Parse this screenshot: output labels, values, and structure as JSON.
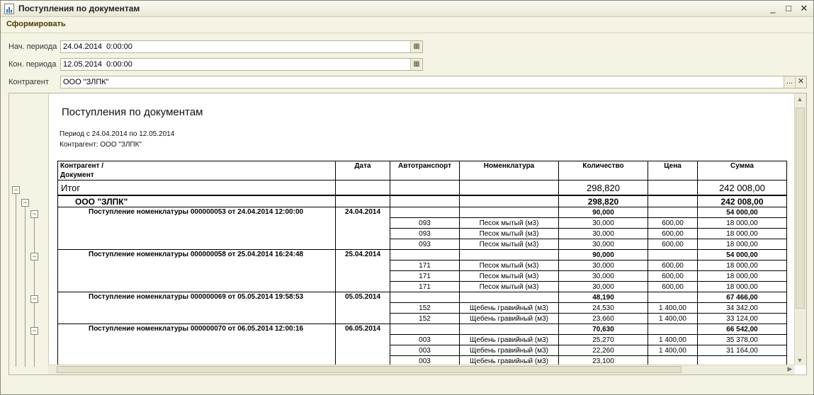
{
  "window": {
    "title": "Поступления по документам",
    "controls": {
      "min": "_",
      "max": "□",
      "close": "✕"
    }
  },
  "toolbar": {
    "generate_label": "Сформировать"
  },
  "form": {
    "start_label": "Нач. периода",
    "start_value": "24.04.2014  0:00:00",
    "end_label": "Кон. периода",
    "end_value": "12.05.2014  0:00:00",
    "counterparty_label": "Контрагент",
    "counterparty_value": "ООО \"ЗЛПК\"",
    "select_glyph": "...",
    "clear_glyph": "✕"
  },
  "report": {
    "title": "Поступления по документам",
    "period_line": "Период с 24.04.2014 по 12.05.2014",
    "counterparty_line": "Контрагент: ООО \"ЗЛПК\"",
    "columns": [
      "Контрагент /\nДокумент",
      "Дата",
      "Автотранспорт",
      "Номенклатура",
      "Количество",
      "Цена",
      "Сумма"
    ],
    "total": {
      "label": "Итог",
      "qty": "298,820",
      "sum": "242 008,00"
    },
    "counterparty_row": {
      "label": "ООО \"ЗЛПК\"",
      "qty": "298,820",
      "sum": "242 008,00"
    },
    "documents": [
      {
        "name": "Поступление номенклатуры 000000053 от 24.04.2014 12:00:00",
        "date": "24.04.2014",
        "qty": "90,000",
        "sum": "54 000,00",
        "lines": [
          {
            "vehicle": "093",
            "item": "Песок мытый (м3)",
            "qty": "30,000",
            "price": "600,00",
            "sum": "18 000,00"
          },
          {
            "vehicle": "093",
            "item": "Песок мытый (м3)",
            "qty": "30,000",
            "price": "600,00",
            "sum": "18 000,00"
          },
          {
            "vehicle": "093",
            "item": "Песок мытый (м3)",
            "qty": "30,000",
            "price": "600,00",
            "sum": "18 000,00"
          }
        ]
      },
      {
        "name": "Поступление номенклатуры 000000058 от 25.04.2014 16:24:48",
        "date": "25.04.2014",
        "qty": "90,000",
        "sum": "54 000,00",
        "lines": [
          {
            "vehicle": "171",
            "item": "Песок мытый (м3)",
            "qty": "30,000",
            "price": "600,00",
            "sum": "18 000,00"
          },
          {
            "vehicle": "171",
            "item": "Песок мытый (м3)",
            "qty": "30,000",
            "price": "600,00",
            "sum": "18 000,00"
          },
          {
            "vehicle": "171",
            "item": "Песок мытый (м3)",
            "qty": "30,000",
            "price": "600,00",
            "sum": "18 000,00"
          }
        ]
      },
      {
        "name": "Поступление номенклатуры 000000069 от 05.05.2014 19:58:53",
        "date": "05.05.2014",
        "qty": "48,190",
        "sum": "67 466,00",
        "lines": [
          {
            "vehicle": "152",
            "item": "Щебень гравийный (м3)",
            "qty": "24,530",
            "price": "1 400,00",
            "sum": "34 342,00"
          },
          {
            "vehicle": "152",
            "item": "Щебень гравийный (м3)",
            "qty": "23,660",
            "price": "1 400,00",
            "sum": "33 124,00"
          }
        ]
      },
      {
        "name": "Поступление номенклатуры 000000070 от 06.05.2014 12:00:16",
        "date": "06.05.2014",
        "qty": "70,630",
        "sum": "66 542,00",
        "lines": [
          {
            "vehicle": "003",
            "item": "Щебень гравийный (м3)",
            "qty": "25,270",
            "price": "1 400,00",
            "sum": "35 378,00"
          },
          {
            "vehicle": "003",
            "item": "Щебень гравийный (м3)",
            "qty": "22,260",
            "price": "1 400,00",
            "sum": "31 164,00"
          },
          {
            "vehicle": "003",
            "item": "Щебень гравийный (м3)",
            "qty": "23,100",
            "price": "",
            "sum": ""
          }
        ]
      }
    ]
  }
}
